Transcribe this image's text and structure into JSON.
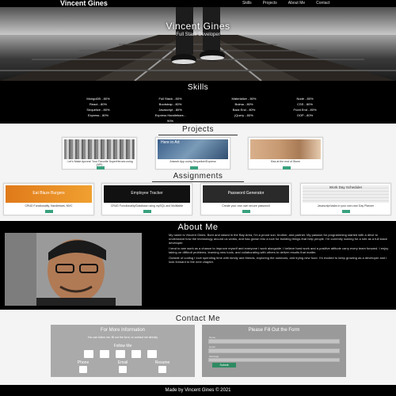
{
  "nav": {
    "brand": "Vincent Gines",
    "links": [
      "Skills",
      "Projects",
      "About Me",
      "Contact"
    ]
  },
  "hero": {
    "title": "Vincent Gines",
    "subtitle": "Full Stack Developer"
  },
  "skills": {
    "title": "Skills",
    "columns": [
      [
        "MongoDB - 80%",
        "React - 80%",
        "Sequelize - 80%",
        "Express - 80%"
      ],
      [
        "Full Stack - 80%",
        "Bootstrap - 80%",
        "Javascript - 80%",
        "Express Handlebars -",
        "90%"
      ],
      [
        "Materialize - 80%",
        "Bulma - 80%",
        "Back End - 80%",
        "jQuery - 80%"
      ],
      [
        "Node - 80%",
        "CSS - 80%",
        "Front End - 80%",
        "OOP - 80%"
      ]
    ]
  },
  "projects": {
    "title": "Projects",
    "items": [
      {
        "caption": "- Let's Make Aprons! Your Favorite SuperHeroes using (API)"
      },
      {
        "caption": "Artwork App using Sequelize/Express"
      },
      {
        "caption": "Kiss at the end of Storm"
      }
    ],
    "thumb_overlay": "Here in Art"
  },
  "assignments": {
    "title": "Assignments",
    "items": [
      {
        "caption": "CRUD Functionality, Handlebars, MVC",
        "thumb": "Eat Blaze Burgers"
      },
      {
        "caption": "CRUD Functionality/Database using mySQL and Multitable",
        "thumb": "Employee Tracker"
      },
      {
        "caption": "Create your own own secure password",
        "thumb": "Password Generator"
      },
      {
        "caption": "Javascript tasks in your own own Day Planner",
        "thumb": "Work Day Scheduler"
      }
    ]
  },
  "about": {
    "title": "About Me",
    "paragraphs": [
      "My name is Vincent Gines. Born and raised in the Bay Area, I'm a proud son, brother, and partner. My passion for programming started with a drive to understand how the technology around us works, and has grown into a love for building things that help people. I'm currently looking for a role as a full stack developer.",
      "I tend to see work as a chance to improve myself and everyone I work alongside. I believe hard work and a positive attitude carry every team forward. I enjoy taking on difficult problems, learning new tools, and collaborating with others to deliver results that matter.",
      "Outside of coding I love spending time with family and friends, exploring the outdoors, and trying new food. I'm excited to keep growing as a developer and I look forward to the next chapter."
    ]
  },
  "contact": {
    "title": "Contact Me",
    "left": {
      "header": "For More Information",
      "text": "You can follow me, fill out the form, or contact me directly.",
      "follow": "Follow Me",
      "labels": [
        "Phone",
        "Email",
        "Resume"
      ]
    },
    "right": {
      "header": "Please Fill Out the Form",
      "fields": [
        "Name",
        "Email",
        "Message"
      ],
      "submit": "Submit"
    }
  },
  "footer": {
    "text": "Made by Vincent Gines © 2021"
  },
  "colors": {
    "accent": "#3aa17e",
    "dark": "#000000",
    "panel": "#aaaaaa"
  }
}
